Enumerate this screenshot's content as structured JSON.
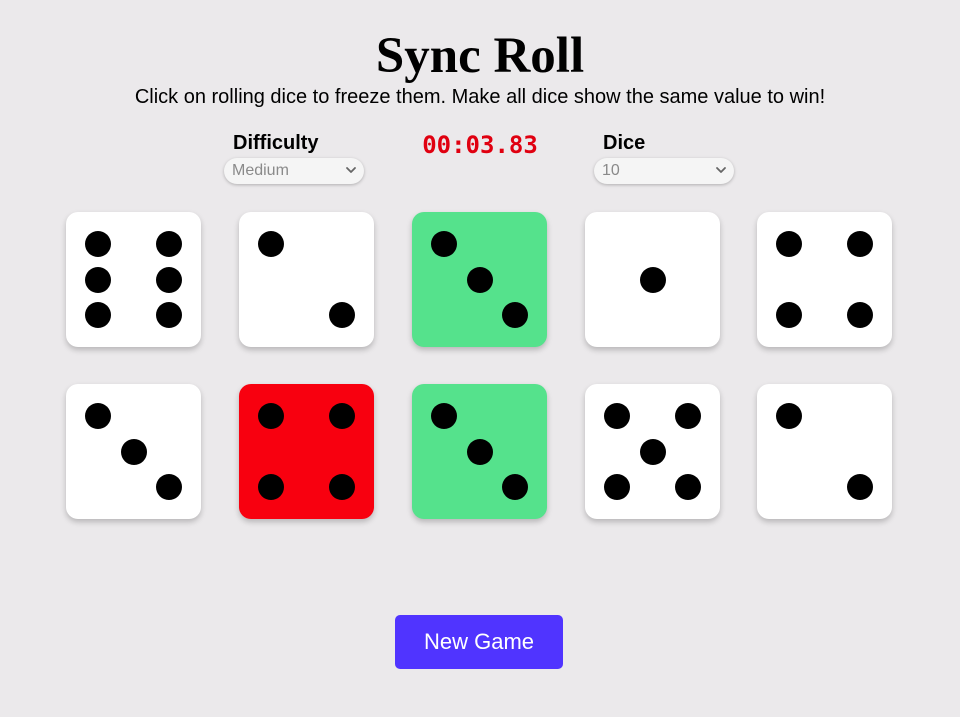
{
  "title": "Sync Roll",
  "subtitle": "Click on rolling dice to freeze them. Make all dice show the same value to win!",
  "difficulty": {
    "label": "Difficulty",
    "selected": "Medium"
  },
  "timer": "00:03.83",
  "dice_count": {
    "label": "Dice",
    "selected": "10"
  },
  "dice": [
    {
      "value": 6,
      "state": "rolling"
    },
    {
      "value": 2,
      "state": "rolling"
    },
    {
      "value": 3,
      "state": "frozen"
    },
    {
      "value": 1,
      "state": "rolling"
    },
    {
      "value": 4,
      "state": "rolling"
    },
    {
      "value": 3,
      "state": "rolling"
    },
    {
      "value": 4,
      "state": "selected"
    },
    {
      "value": 3,
      "state": "frozen"
    },
    {
      "value": 5,
      "state": "rolling"
    },
    {
      "value": 2,
      "state": "rolling"
    }
  ],
  "colors": {
    "frozen": "#55e28c",
    "selected": "#f8000f",
    "timer": "#e00010",
    "button": "#5034ff"
  },
  "new_game_label": "New Game"
}
